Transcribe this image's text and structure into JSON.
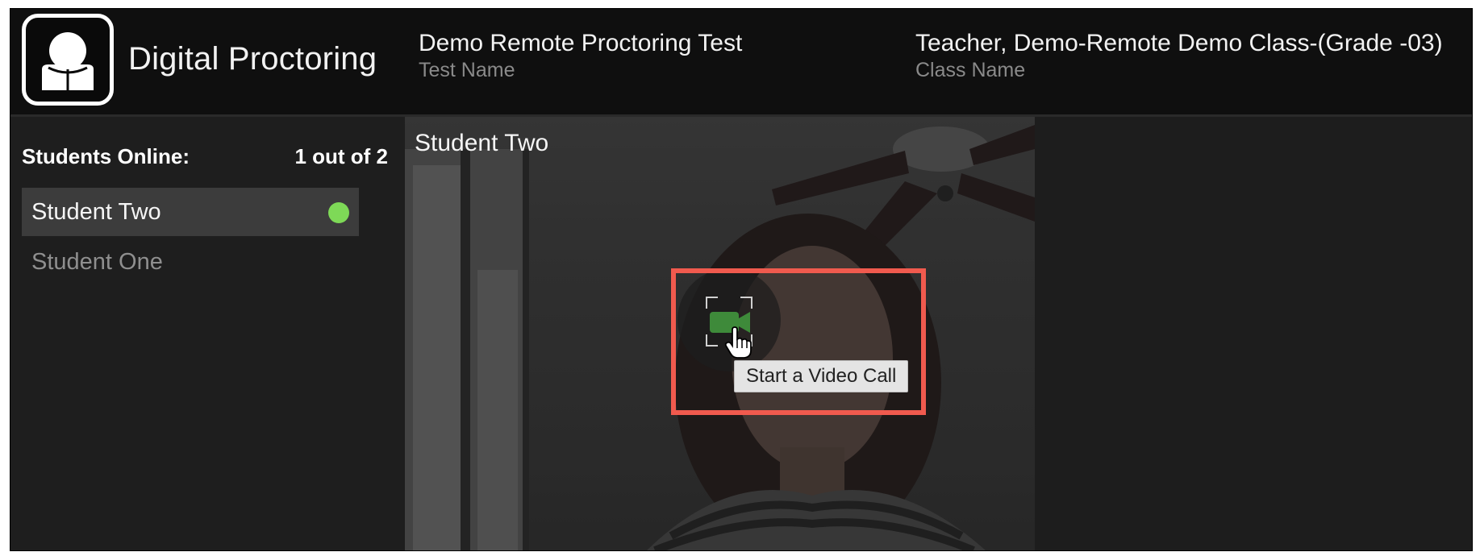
{
  "header": {
    "app_title": "Digital Proctoring",
    "test": {
      "value": "Demo Remote Proctoring Test",
      "label": "Test Name"
    },
    "class": {
      "value": "Teacher, Demo-Remote Demo Class-(Grade -03)",
      "label": "Class Name"
    }
  },
  "sidebar": {
    "students_online_label": "Students Online:",
    "students_online_count": "1 out of 2",
    "students": [
      {
        "name": "Student Two",
        "status": "online",
        "selected": true
      },
      {
        "name": "Student One",
        "status": "offline",
        "selected": false
      }
    ]
  },
  "video": {
    "student_name": "Student Two",
    "call_button_icon": "video-call-icon",
    "tooltip": "Start a Video Call"
  },
  "colors": {
    "online_dot": "#7ed957",
    "callout_border": "#f05a4e",
    "call_icon_green": "#3e8a3a"
  }
}
